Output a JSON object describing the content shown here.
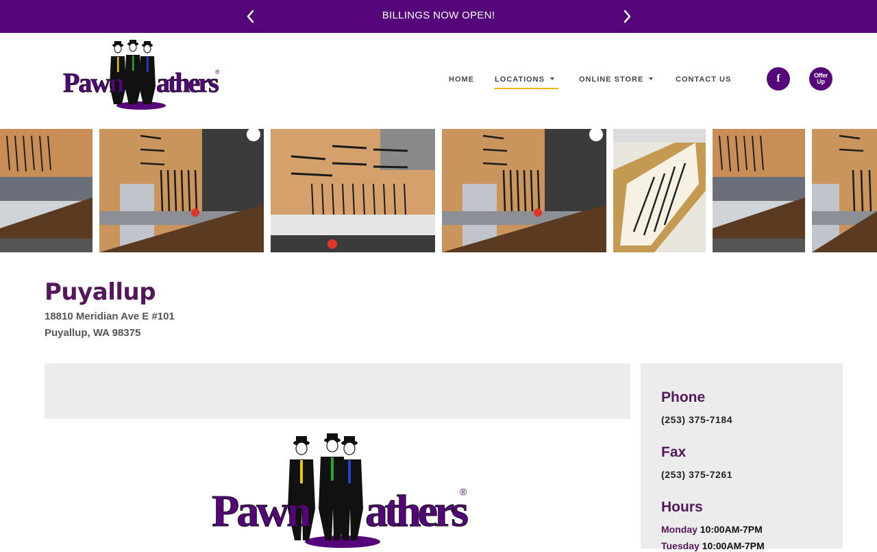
{
  "announcement": {
    "text": "BILLINGS NOW OPEN!"
  },
  "header": {
    "logo_text": "PawnFathers",
    "nav": [
      {
        "label": "HOME"
      },
      {
        "label": "LOCATIONS"
      },
      {
        "label": "ONLINE STORE"
      },
      {
        "label": "CONTACT US"
      }
    ],
    "social": {
      "facebook": "f",
      "offerup": "Offer Up"
    }
  },
  "location": {
    "name": "Puyallup",
    "address_line1": "18810 Meridian Ave E #101",
    "address_line2": "Puyallup, WA 98375"
  },
  "sidebar": {
    "phone_label": "Phone",
    "phone": "(253) 375-7184",
    "fax_label": "Fax",
    "fax": "(253) 375-7261",
    "hours_label": "Hours",
    "hours": [
      {
        "day": "Monday",
        "time": "10:00AM-7PM"
      },
      {
        "day": "Tuesday",
        "time": "10:00AM-7PM"
      }
    ]
  },
  "colors": {
    "brand": "#55047a",
    "accent": "#f0b400",
    "heading": "#55165a"
  }
}
